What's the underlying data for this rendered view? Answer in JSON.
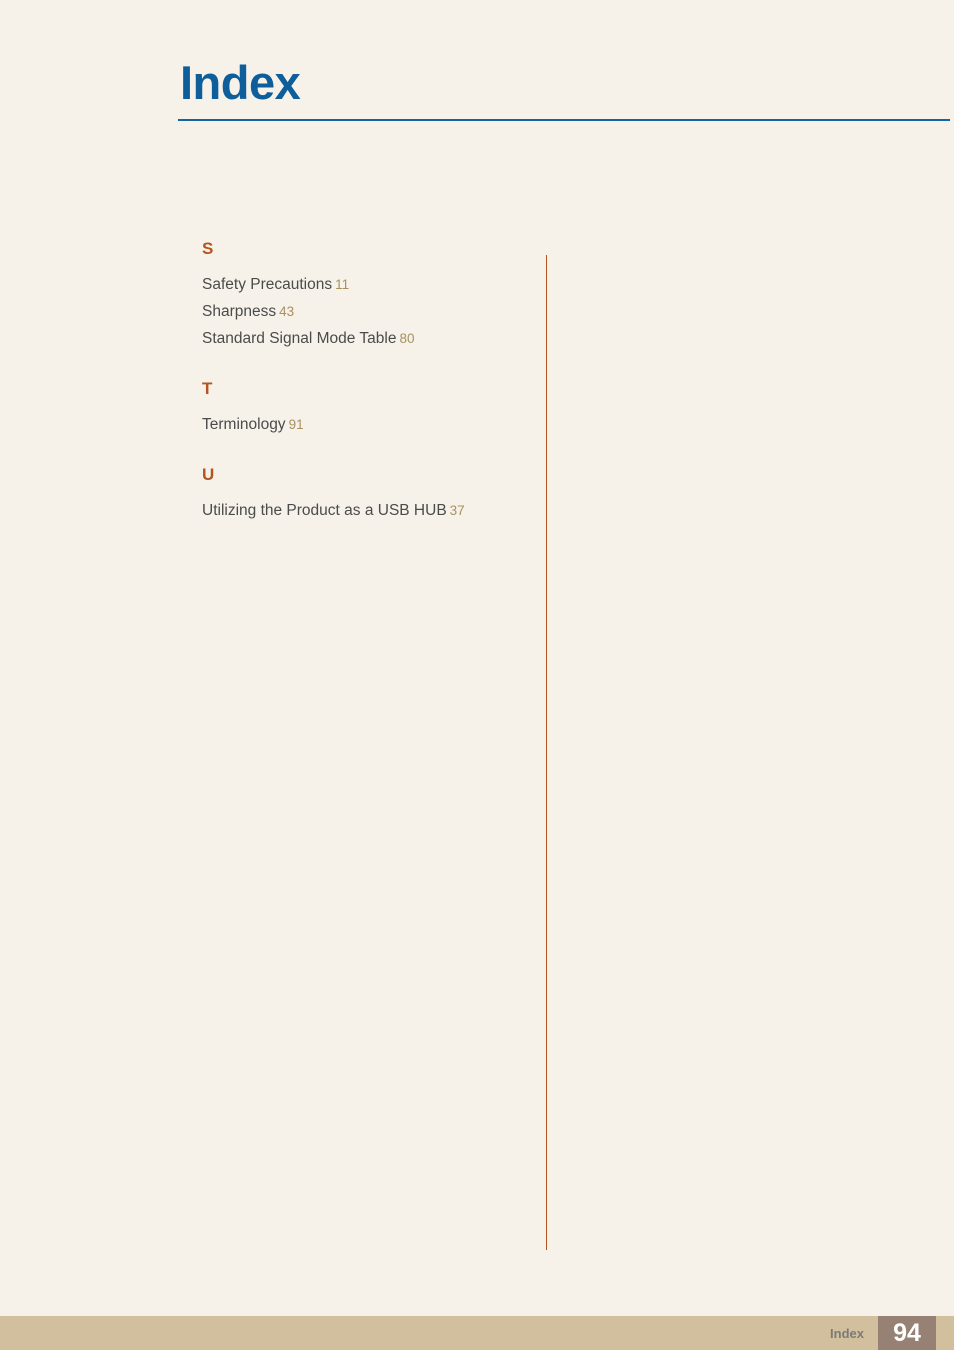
{
  "document": {
    "title": "Index",
    "background_color": "#f6f2e9",
    "title_color": "#0e5e9c",
    "accent_color": "#b5541f",
    "page_number_color": "#a8915f"
  },
  "index": {
    "groups": [
      {
        "letter": "S",
        "entries": [
          {
            "text": "Safety Precautions",
            "page": "11"
          },
          {
            "text": "Sharpness",
            "page": "43"
          },
          {
            "text": "Standard Signal Mode Table",
            "page": "80"
          }
        ]
      },
      {
        "letter": "T",
        "entries": [
          {
            "text": "Terminology",
            "page": "91"
          }
        ]
      },
      {
        "letter": "U",
        "entries": [
          {
            "text": "Utilizing the Product as a USB HUB",
            "page": "37"
          }
        ]
      }
    ]
  },
  "footer": {
    "section_label": "Index",
    "page_number": "94",
    "band_color": "#d2bf9e",
    "page_box_color": "#978175"
  }
}
